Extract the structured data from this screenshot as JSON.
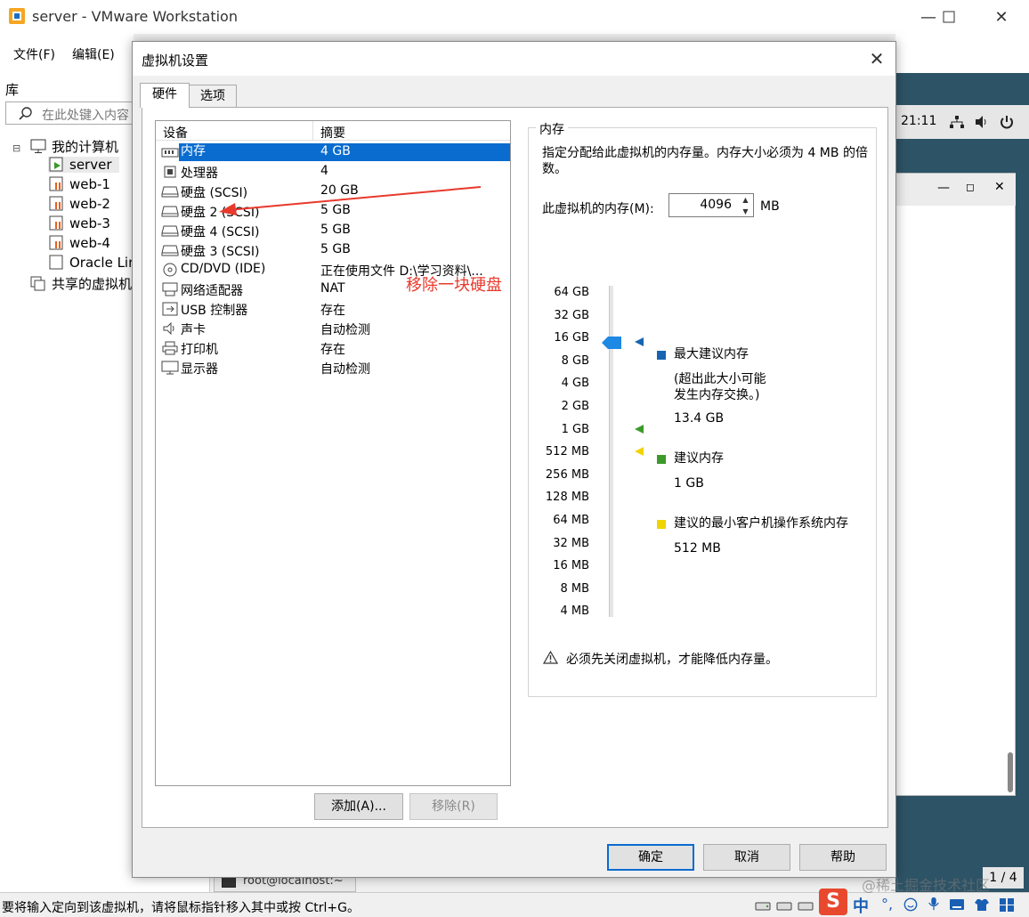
{
  "window": {
    "title": "server - VMware Workstation"
  },
  "menu": {
    "file": "文件(F)",
    "edit": "编辑(E)"
  },
  "library": {
    "title": "库",
    "search_placeholder": "在此处键入内容",
    "tree": {
      "root": "我的计算机",
      "vms": [
        "server",
        "web-1",
        "web-2",
        "web-3",
        "web-4",
        "Oracle Lir"
      ],
      "shared": "共享的虚拟机"
    }
  },
  "guest": {
    "clock": "21:11",
    "terminal_tab": "root@localhost:~",
    "pager": "1 / 4"
  },
  "statusbar": {
    "message": "要将输入定向到该虚拟机，请将鼠标指针移入其中或按 Ctrl+G。",
    "watermark": "@稀土掘金技术社区"
  },
  "ime": {
    "logo": "S",
    "mode": "中"
  },
  "dialog": {
    "title": "虚拟机设置",
    "tabs": {
      "hardware": "硬件",
      "options": "选项"
    },
    "list_headers": {
      "device": "设备",
      "summary": "摘要"
    },
    "devices": [
      {
        "name": "内存",
        "summary": "4 GB",
        "icon": "memory-icon"
      },
      {
        "name": "处理器",
        "summary": "4",
        "icon": "cpu-icon"
      },
      {
        "name": "硬盘 (SCSI)",
        "summary": "20 GB",
        "icon": "hard-disk-icon"
      },
      {
        "name": "硬盘 2 (SCSI)",
        "summary": "5 GB",
        "icon": "hard-disk-icon"
      },
      {
        "name": "硬盘 4 (SCSI)",
        "summary": "5 GB",
        "icon": "hard-disk-icon"
      },
      {
        "name": "硬盘 3 (SCSI)",
        "summary": "5 GB",
        "icon": "hard-disk-icon"
      },
      {
        "name": "CD/DVD (IDE)",
        "summary": "正在使用文件 D:\\学习资料\\...",
        "icon": "cd-dvd-icon"
      },
      {
        "name": "网络适配器",
        "summary": "NAT",
        "icon": "network-adapter-icon"
      },
      {
        "name": "USB 控制器",
        "summary": "存在",
        "icon": "usb-icon"
      },
      {
        "name": "声卡",
        "summary": "自动检测",
        "icon": "sound-card-icon"
      },
      {
        "name": "打印机",
        "summary": "存在",
        "icon": "printer-icon"
      },
      {
        "name": "显示器",
        "summary": "自动检测",
        "icon": "display-icon"
      }
    ],
    "add_button": "添加(A)...",
    "remove_button": "移除(R)",
    "annotation": "移除一块硬盘",
    "memory": {
      "group_title": "内存",
      "description": "指定分配给此虚拟机的内存量。内存大小必须为 4 MB 的倍数。",
      "field_label": "此虚拟机的内存(M):",
      "value": "4096",
      "unit": "MB",
      "scale": [
        "64 GB",
        "32 GB",
        "16 GB",
        "8 GB",
        "4 GB",
        "2 GB",
        "1 GB",
        "512 MB",
        "256 MB",
        "128 MB",
        "64 MB",
        "32 MB",
        "16 MB",
        "8 MB",
        "4 MB"
      ],
      "max_recommended": {
        "title": "最大建议内存",
        "note_line1": "(超出此大小可能",
        "note_line2": "发生内存交换。)",
        "value": "13.4 GB",
        "color": "#1565b0"
      },
      "recommended": {
        "title": "建议内存",
        "value": "1 GB",
        "color": "#3c9a2a"
      },
      "min_guest": {
        "title": "建议的最小客户机操作系统内存",
        "value": "512 MB",
        "color": "#f0d400"
      },
      "warning": "必须先关闭虚拟机，才能降低内存量。"
    },
    "ok_button": "确定",
    "cancel_button": "取消",
    "help_button": "帮助"
  }
}
